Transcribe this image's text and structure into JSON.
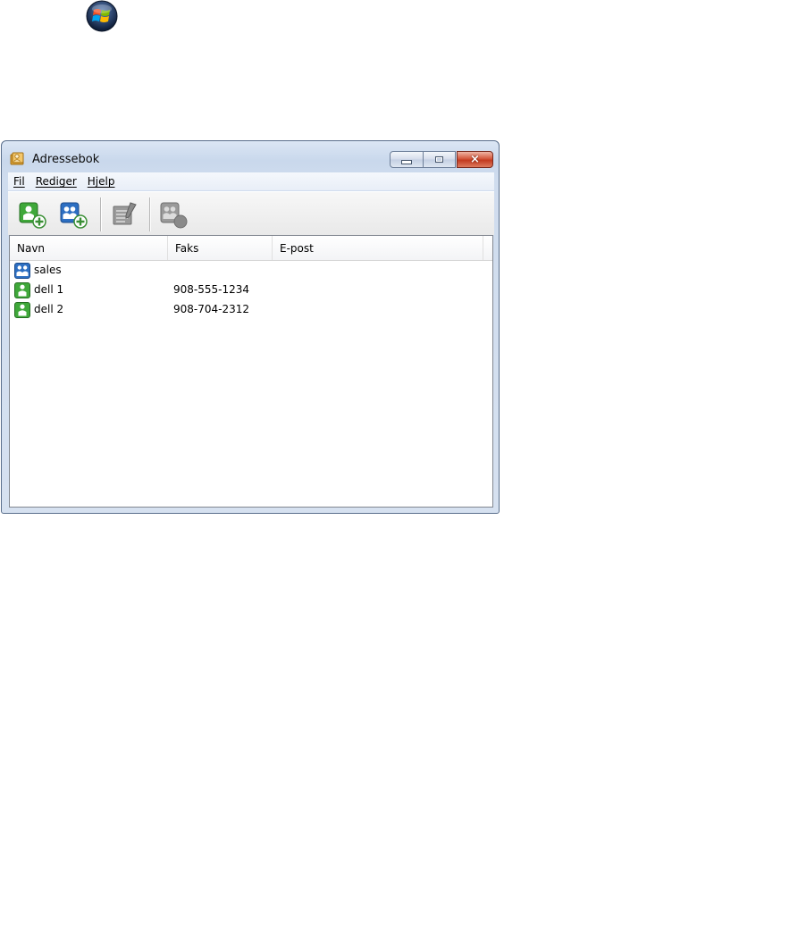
{
  "window": {
    "title": "Adressebok",
    "controls": {
      "minimize": "minimize",
      "maximize": "maximize",
      "close": "×"
    }
  },
  "menu": {
    "items": [
      {
        "label": "Fil"
      },
      {
        "label": "Rediger"
      },
      {
        "label": "Hjelp"
      }
    ]
  },
  "toolbar": {
    "buttons": [
      {
        "icon": "add-contact-icon",
        "enabled": true
      },
      {
        "icon": "add-group-icon",
        "enabled": true
      },
      {
        "icon": "edit-icon",
        "enabled": false
      },
      {
        "icon": "delete-icon",
        "enabled": false
      }
    ]
  },
  "list": {
    "columns": [
      "Navn",
      "Faks",
      "E-post"
    ],
    "rows": [
      {
        "type": "group",
        "icon": "group-icon",
        "name": "sales",
        "fax": "",
        "email": ""
      },
      {
        "type": "contact",
        "icon": "contact-icon",
        "name": "dell 1",
        "fax": "908-555-1234",
        "email": ""
      },
      {
        "type": "contact",
        "icon": "contact-icon",
        "name": "dell 2",
        "fax": "908-704-2312",
        "email": ""
      }
    ]
  },
  "colors": {
    "contact_green": "#3fa83a",
    "group_blue": "#2d6fc2",
    "close_red": "#c23a20"
  }
}
